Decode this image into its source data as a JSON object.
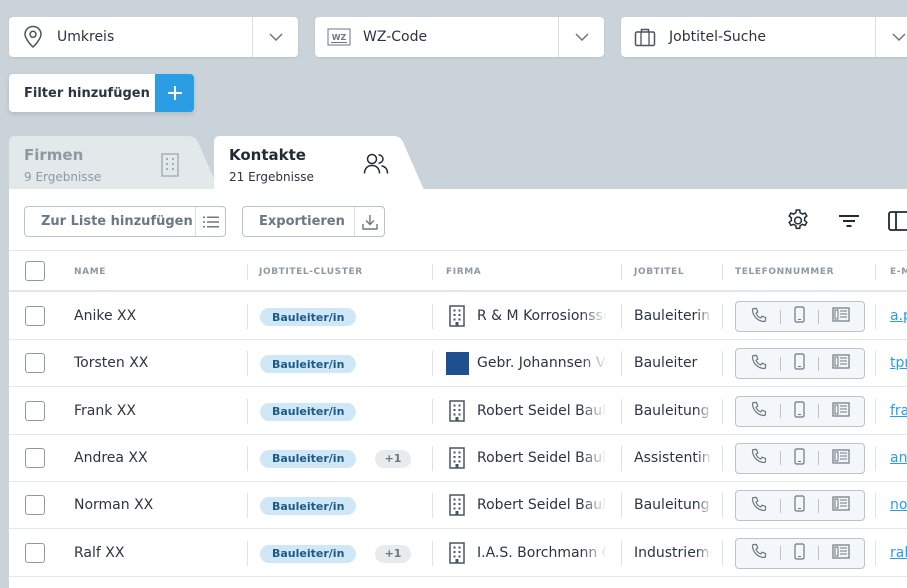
{
  "filters": [
    {
      "label": "Umkreis",
      "icon": "location-pin-icon"
    },
    {
      "label": "WZ-Code",
      "icon": "wz-code-icon"
    },
    {
      "label": "Jobtitel-Suche",
      "icon": "briefcase-icon"
    }
  ],
  "add_filter": {
    "label": "Filter hinzufügen"
  },
  "tabs": [
    {
      "title": "Firmen",
      "subtitle": "9 Ergebnisse",
      "active": false
    },
    {
      "title": "Kontakte",
      "subtitle": "21 Ergebnisse",
      "active": true
    }
  ],
  "toolbar": {
    "add_to_list": "Zur Liste hinzufügen",
    "export": "Exportieren"
  },
  "columns": {
    "name": "NAME",
    "cluster": "JOBTITEL-CLUSTER",
    "firma": "FIRMA",
    "jobtitel": "JOBTITEL",
    "telefon": "TELEFONNUMMER",
    "email": "E-M"
  },
  "rows": [
    {
      "name": "Anike XX",
      "cluster": "Bauleiter/in",
      "extra": "",
      "firma": "R & M Korrosionssch",
      "firma_logo": false,
      "jobtitel": "Bauleiterin",
      "email": "a.p"
    },
    {
      "name": "Torsten XX",
      "cluster": "Bauleiter/in",
      "extra": "",
      "firma": "Gebr. Johannsen Ver",
      "firma_logo": true,
      "jobtitel": "Bauleiter",
      "email": "tpr"
    },
    {
      "name": "Frank XX",
      "cluster": "Bauleiter/in",
      "extra": "",
      "firma": "Robert Seidel Baule",
      "firma_logo": false,
      "jobtitel": "Bauleitung",
      "email": "fra"
    },
    {
      "name": "Andrea XX",
      "cluster": "Bauleiter/in",
      "extra": "+1",
      "firma": "Robert Seidel Baule",
      "firma_logo": false,
      "jobtitel": "Assistentin",
      "email": "and"
    },
    {
      "name": "Norman XX",
      "cluster": "Bauleiter/in",
      "extra": "",
      "firma": "Robert Seidel Baule",
      "firma_logo": false,
      "jobtitel": "Bauleitung",
      "email": "no"
    },
    {
      "name": "Ralf XX",
      "cluster": "Bauleiter/in",
      "extra": "+1",
      "firma": "I.A.S. Borchmann Gn",
      "firma_logo": false,
      "jobtitel": "Industrieme",
      "email": "ral"
    }
  ],
  "colors": {
    "accent": "#2a9de4",
    "badge_bg": "#cfe7f7",
    "page_bg": "#c9d3d9"
  }
}
